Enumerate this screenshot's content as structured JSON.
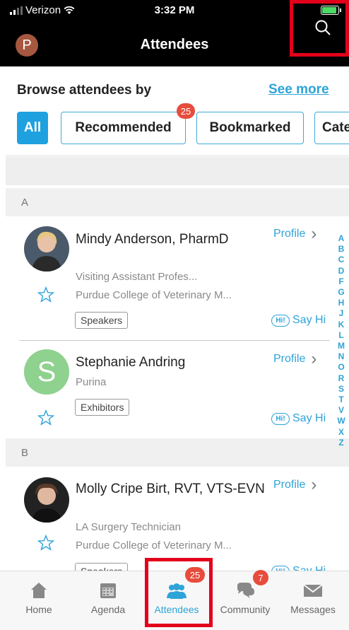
{
  "status_bar": {
    "carrier": "Verizon",
    "time": "3:32 PM"
  },
  "nav": {
    "avatar_initial": "P",
    "title": "Attendees"
  },
  "browse": {
    "title": "Browse attendees by",
    "see_more": "See more"
  },
  "filters": {
    "all": "All",
    "recommended": "Recommended",
    "recommended_badge": "25",
    "bookmarked": "Bookmarked",
    "categories": "Cate"
  },
  "sections": [
    {
      "letter": "A"
    },
    {
      "letter": "B"
    }
  ],
  "attendees": [
    {
      "name": "Mindy Anderson, PharmD",
      "title": "Visiting Assistant Profes...",
      "org": "Purdue College of Veterinary M...",
      "tag": "Speakers",
      "profile": "Profile",
      "say_hi": "Say Hi",
      "hi": "Hi!"
    },
    {
      "name": "Stephanie Andring",
      "initial": "S",
      "org": "Purina",
      "tag": "Exhibitors",
      "profile": "Profile",
      "say_hi": "Say Hi",
      "hi": "Hi!"
    },
    {
      "name": "Molly Cripe Birt, RVT, VTS-EVN",
      "title": "LA Surgery Technician",
      "org": "Purdue College of Veterinary M...",
      "tag": "Speakers",
      "profile": "Profile",
      "say_hi": "Say Hi",
      "hi": "Hi!"
    }
  ],
  "alphabet": [
    "A",
    "B",
    "C",
    "D",
    "F",
    "G",
    "H",
    "J",
    "K",
    "L",
    "M",
    "N",
    "O",
    "R",
    "S",
    "T",
    "V",
    "W",
    "X",
    "Z"
  ],
  "tabs": {
    "home": "Home",
    "agenda": "Agenda",
    "attendees": "Attendees",
    "attendees_badge": "25",
    "community": "Community",
    "community_badge": "7",
    "messages": "Messages"
  },
  "colors": {
    "accent": "#2ea3d8",
    "badge": "#e74c3c",
    "highlight": "#e3001b",
    "avatar": "#a6573f",
    "initial_avatar": "#8fd18e"
  }
}
